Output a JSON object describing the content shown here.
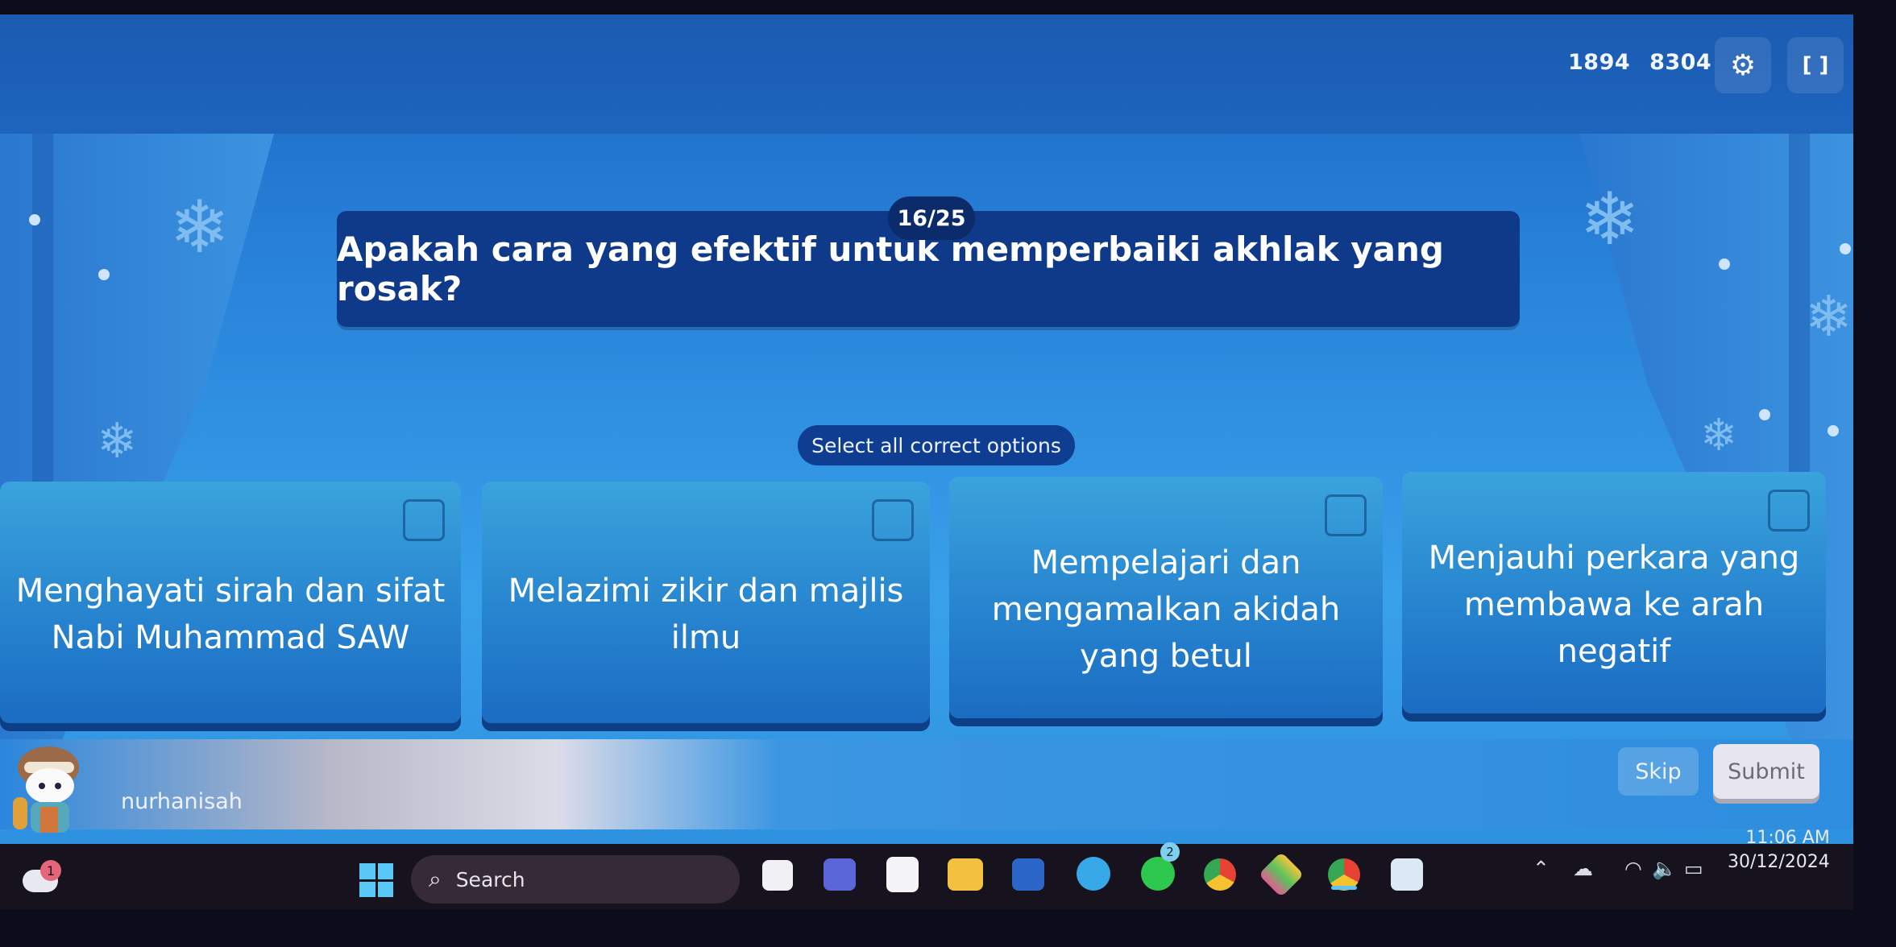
{
  "header": {
    "stat_1": "1894",
    "stat_2": "8304",
    "settings_icon": "gear-icon",
    "fullscreen_icon": "fullscreen-icon"
  },
  "question": {
    "counter": "16/25",
    "text": "Apakah cara yang efektif untuk memperbaiki akhlak yang rosak?",
    "instruction": "Select all correct options"
  },
  "options": [
    {
      "label": "Menghayati sirah dan sifat Nabi Muhammad SAW",
      "checked": false
    },
    {
      "label": "Melazimi zikir dan majlis ilmu",
      "checked": false
    },
    {
      "label": "Mempelajari dan mengamalkan akidah yang betul",
      "checked": false
    },
    {
      "label": "Menjauhi perkara yang membawa ke arah negatif",
      "checked": false
    }
  ],
  "player": {
    "username": "nurhanisah"
  },
  "actions": {
    "skip_label": "Skip",
    "submit_label": "Submit"
  },
  "taskbar": {
    "weather_badge": "1",
    "search_placeholder": "Search",
    "apps": [
      "task-view",
      "teams",
      "microsoft-store",
      "file-explorer",
      "word",
      "telegram",
      "whatsapp",
      "chrome",
      "bluestacks",
      "chrome",
      "copilot"
    ],
    "whatsapp_badge": "2",
    "time": "11:06 AM",
    "date": "30/12/2024"
  },
  "colors": {
    "question_bg": "#0f3a8a",
    "option_bg": "#2784cf",
    "submit_bg": "#e7e6ee"
  }
}
